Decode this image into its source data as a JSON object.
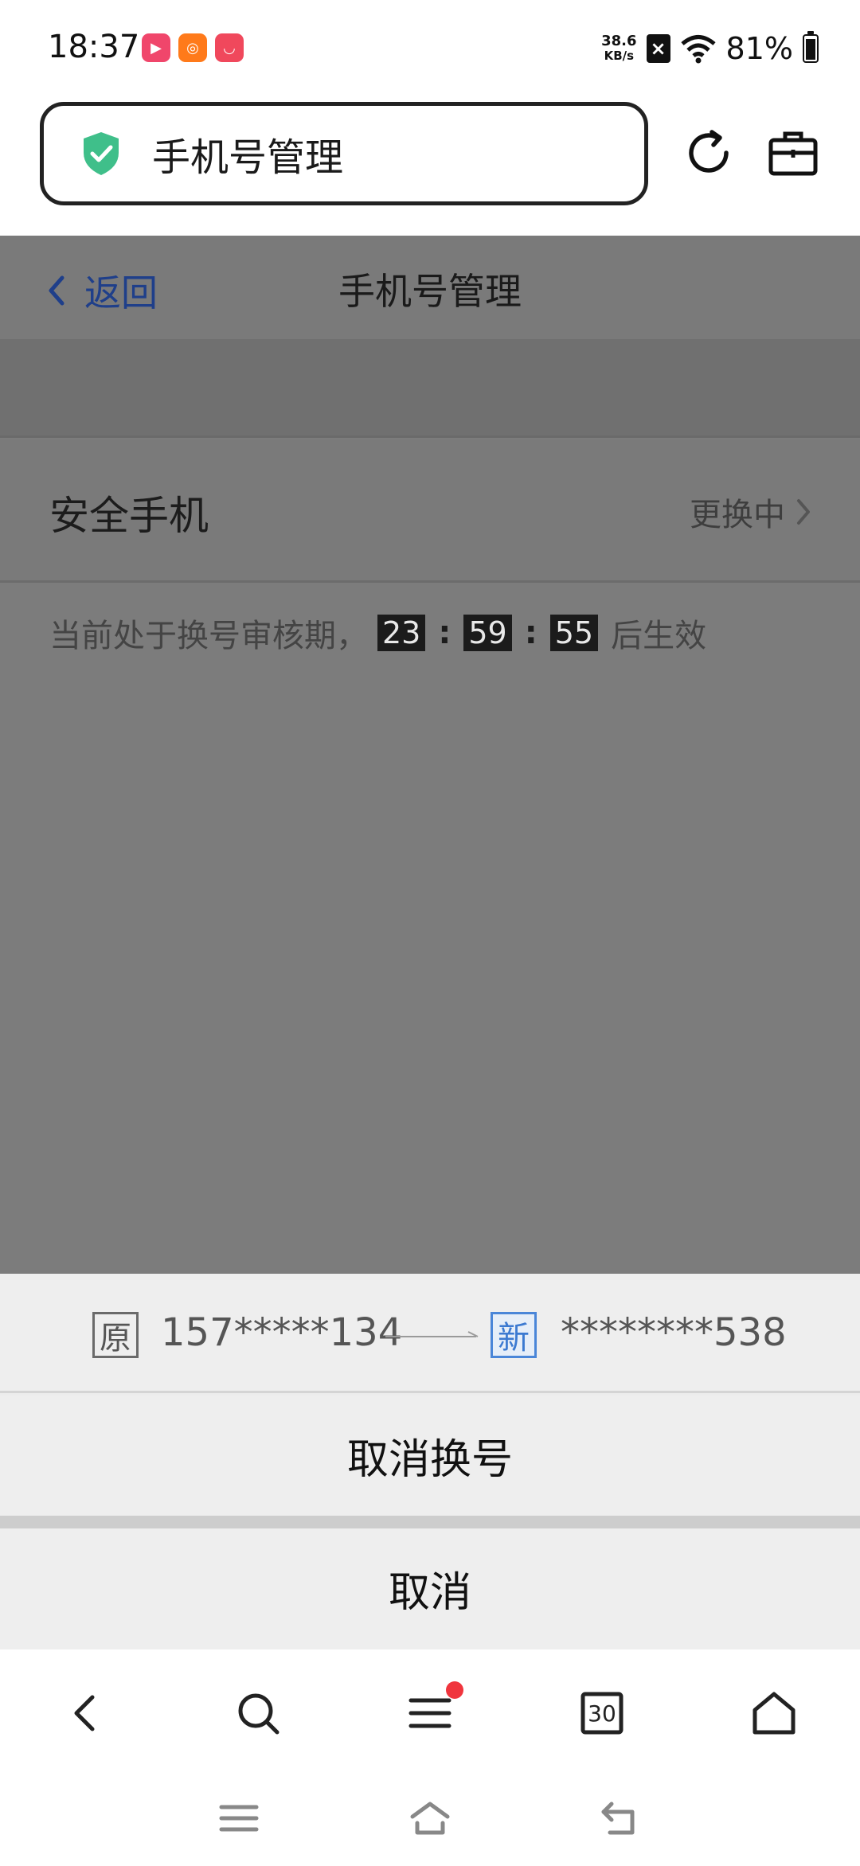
{
  "status_bar": {
    "time": "18:37",
    "net_speed_value": "38.6",
    "net_speed_unit": "KB/s",
    "battery": "81%",
    "app_icons": [
      "video-app-icon",
      "kuaishou-icon",
      "huawei-store-icon"
    ]
  },
  "browser": {
    "address_title": "手机号管理"
  },
  "page": {
    "back_label": "返回",
    "title": "手机号管理",
    "row_label": "安全手机",
    "row_status": "更换中",
    "notice_prefix": "当前处于换号审核期，",
    "countdown_hours": "23",
    "countdown_minutes": "59",
    "countdown_seconds": "55",
    "colon": ":",
    "notice_suffix": "后生效"
  },
  "sheet": {
    "old_tag": "原",
    "old_number": "157*****134",
    "new_tag": "新",
    "new_number": "********538",
    "cancel_change_label": "取消换号",
    "cancel_label": "取消"
  },
  "toolbar": {
    "tab_count": "30",
    "has_notification_dot": true
  },
  "colors": {
    "overlay": "#7c7c7c",
    "link_blue": "#1f3f8a",
    "shield_green": "#3fbf8a",
    "new_tag_blue": "#3c7ad1",
    "notification_red": "#f0353d"
  }
}
